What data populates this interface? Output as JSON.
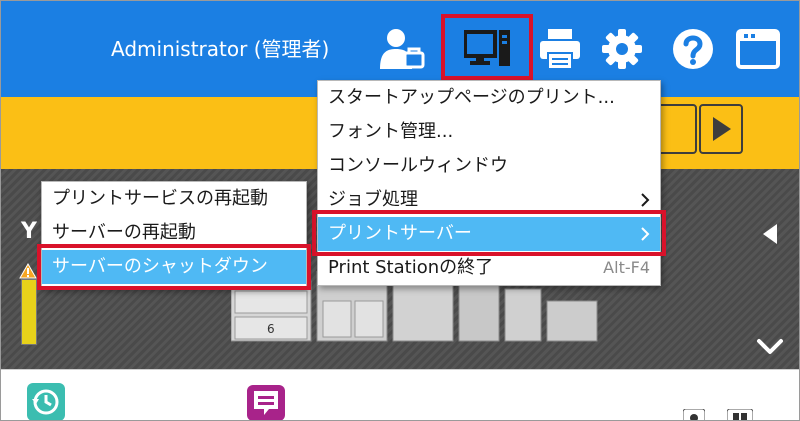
{
  "header": {
    "user_label": "Administrator (管理者)",
    "icons": [
      "user-admin-icon",
      "console-window-icon",
      "printer-icon",
      "gear-icon",
      "help-icon",
      "app-window-icon"
    ]
  },
  "main_menu": {
    "items": [
      {
        "label": "スタートアップページのプリント...",
        "shortcut": ""
      },
      {
        "label": "フォント管理...",
        "shortcut": ""
      },
      {
        "label": "コンソールウィンドウ",
        "shortcut": ""
      },
      {
        "label": "ジョブ処理",
        "shortcut": ""
      },
      {
        "label": "プリントサーバー",
        "shortcut": ""
      },
      {
        "label": "Print Stationの終了",
        "shortcut": "Alt-F4"
      }
    ]
  },
  "sub_menu": {
    "items": [
      {
        "label": "プリントサービスの再起動"
      },
      {
        "label": "サーバーの再起動"
      },
      {
        "label": "サーバーのシャットダウン"
      }
    ]
  },
  "status": {
    "toner_label": "Y",
    "tray_label": "6"
  },
  "colors": {
    "header_blue": "#1b7fe3",
    "control_yellow": "#fbbf15",
    "highlight_red": "#d9122a",
    "selection_blue": "#4fb9f4"
  }
}
